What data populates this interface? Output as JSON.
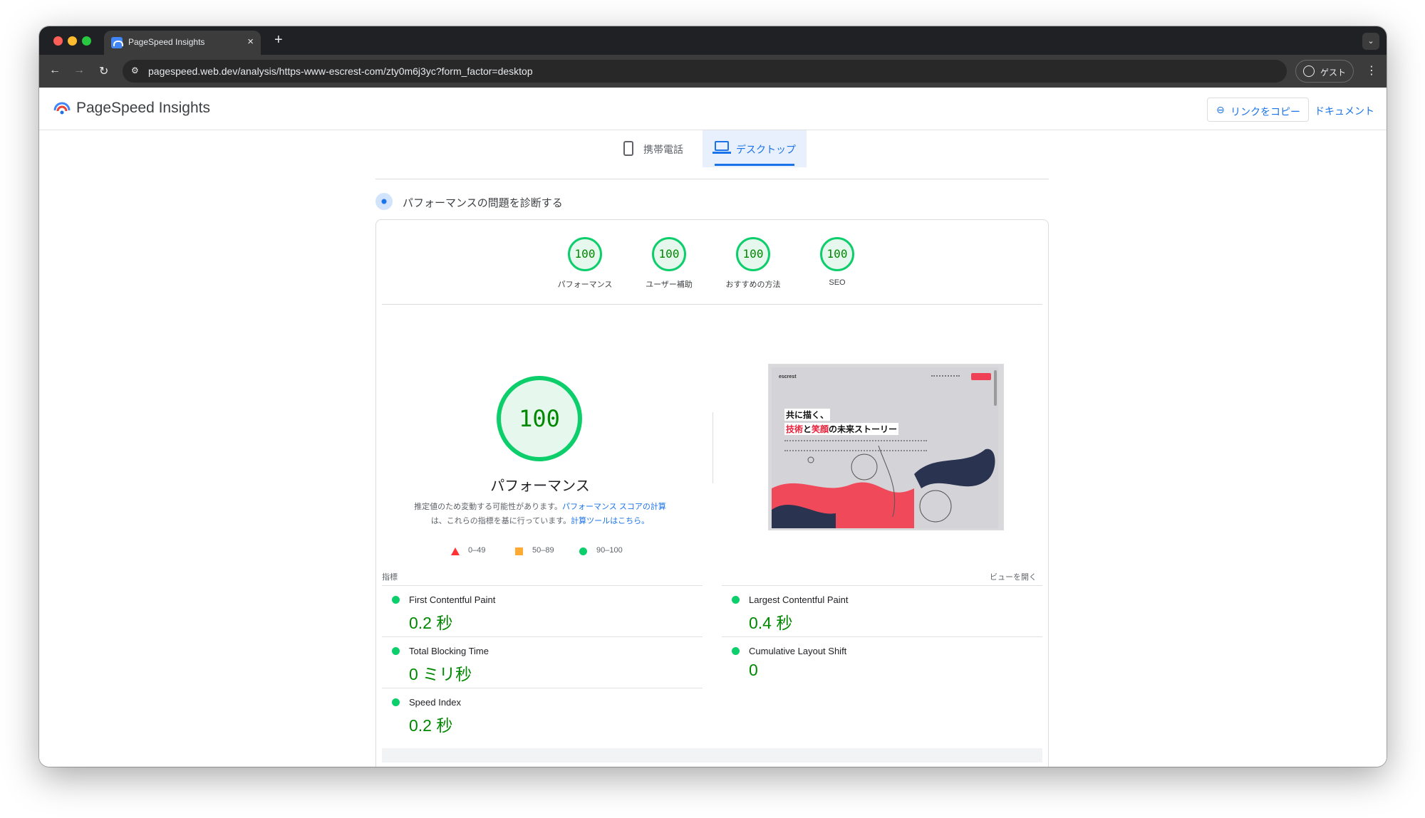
{
  "browser": {
    "tab_title": "PageSpeed Insights",
    "tab_close": "×",
    "new_tab": "+",
    "tab_menu": "⌄",
    "back": "←",
    "forward": "→",
    "reload": "↻",
    "url": "pagespeed.web.dev/analysis/https-www-escrest-com/zty0m6j3yc?form_factor=desktop",
    "profile_label": "ゲスト",
    "menu": "⋮"
  },
  "header": {
    "title": "PageSpeed Insights",
    "copy_link_icon": "⊖",
    "copy_link_label": "リンクをコピー",
    "docs_label": "ドキュメント"
  },
  "device_tabs": {
    "mobile_label": "携帯電話",
    "desktop_label": "デスクトップ",
    "selected": "desktop"
  },
  "diagnose": {
    "label": "パフォーマンスの問題を診断する"
  },
  "scores": [
    {
      "value": "100",
      "label": "パフォーマンス"
    },
    {
      "value": "100",
      "label": "ユーザー補助"
    },
    {
      "value": "100",
      "label": "おすすめの方法"
    },
    {
      "value": "100",
      "label": "SEO"
    }
  ],
  "performance": {
    "score": "100",
    "label": "パフォーマンス",
    "note_1": "推定値のため変動する可能性があります。",
    "note_link_1": "パフォーマンス スコアの計算",
    "note_2": "は、これらの指標を基に行っています。",
    "note_link_2": "計算ツールはこちら。"
  },
  "legend": [
    {
      "range": "0–49",
      "color": "#ff3333"
    },
    {
      "range": "50–89",
      "color": "#ffaa33"
    },
    {
      "range": "90–100",
      "color": "#0cce6b"
    }
  ],
  "screenshot": {
    "logo": "escrest",
    "headline_1": "共に描く、",
    "headline_2a": "技術",
    "headline_2b": "と",
    "headline_2c": "笑顔",
    "headline_2d": "の未来ストーリー"
  },
  "metrics": {
    "heading": "指標",
    "expand_label": "ビューを開く",
    "items": [
      {
        "label": "First Contentful Paint",
        "value": "0.2 秒"
      },
      {
        "label": "Largest Contentful Paint",
        "value": "0.4 秒"
      },
      {
        "label": "Total Blocking Time",
        "value": "0 ミリ秒"
      },
      {
        "label": "Cumulative Layout Shift",
        "value": "0"
      },
      {
        "label": "Speed Index",
        "value": "0.2 秒"
      }
    ]
  },
  "colors": {
    "pass_green": "#0cce6b",
    "pass_text": "#008800",
    "link_blue": "#1a73e8"
  }
}
